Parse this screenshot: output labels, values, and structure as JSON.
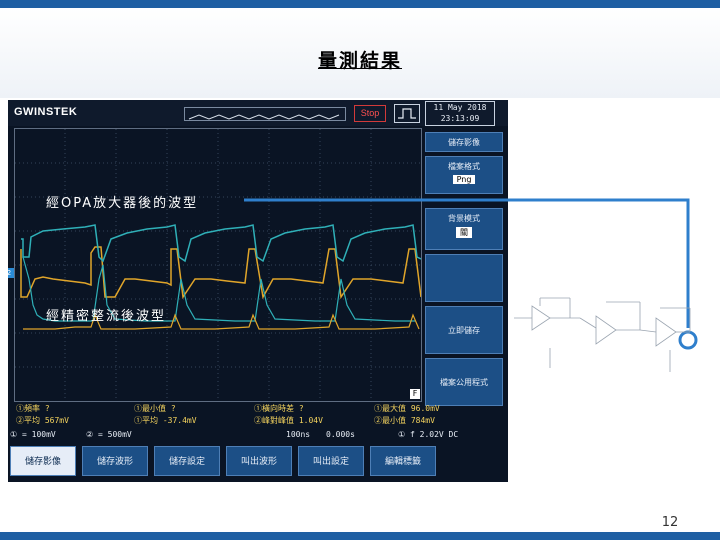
{
  "slide": {
    "title": "量測結果",
    "page_number": "12"
  },
  "scope": {
    "logo": "GWINSTEK",
    "run_state": "Stop",
    "date_line1": "11 May 2018",
    "date_line2": "23:13:09",
    "softkeys": [
      {
        "label": "儲存影像",
        "value": ""
      },
      {
        "label": "檔案格式",
        "value": "Png"
      },
      {
        "label": "背景模式",
        "value": "關"
      },
      {
        "label": "",
        "value": ""
      },
      {
        "label": "立即儲存",
        "value": ""
      },
      {
        "label": "檔案公用程式",
        "value": ""
      }
    ],
    "measurements": {
      "row1": [
        {
          "label": "①頻率 ?"
        },
        {
          "label": "①最小值 ?"
        },
        {
          "label": "①橫向時差 ?"
        },
        {
          "label": "①最大值 96.0mV"
        }
      ],
      "row2": [
        {
          "label": "②平均 567mV"
        },
        {
          "label": "①平均 -37.4mV"
        },
        {
          "label": "②峰對峰值 1.04V"
        },
        {
          "label": "②最小值 784mV"
        }
      ]
    },
    "status": {
      "ch1": "① = 100mV",
      "ch2": "② = 500mV",
      "timebase": "100ns",
      "offset": "0.000s",
      "trigger": "① f  2.02V  DC"
    },
    "bottom_menu": [
      "儲存影像",
      "儲存波形",
      "儲存設定",
      "叫出波形",
      "叫出設定",
      "編輯標籤"
    ]
  },
  "annotations": {
    "opa_note": "經OPA放大器後的波型",
    "rect_note": "經精密整流後波型"
  },
  "colors": {
    "ch1": "#e0a52a",
    "ch2": "#2fb0b8",
    "connector": "#2f7fcc"
  }
}
